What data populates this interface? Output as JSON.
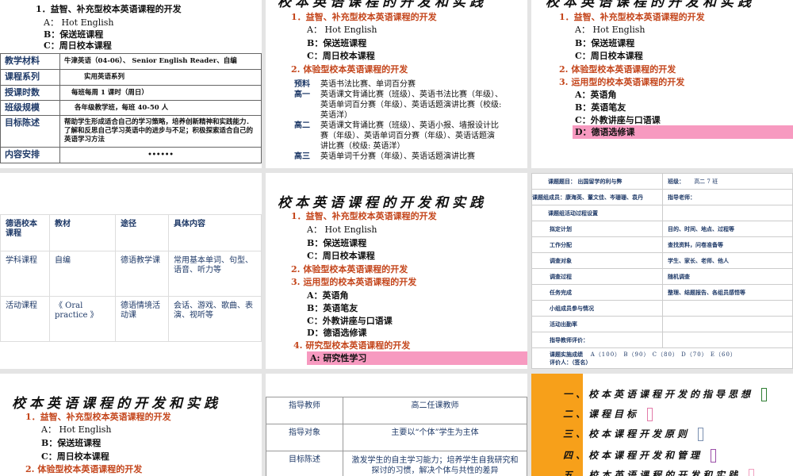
{
  "common": {
    "title": "校本英语课程的开发和实践",
    "item1": "1．益智、补充型校本英语课程的开发",
    "item1_a": "A： Hot English",
    "item1_b": "B：保送班课程",
    "item1_c": "C：周日校本课程",
    "item2": "2. 体验型校本英语课程的开发",
    "item3": "3. 运用型的校本英语课程的开发",
    "item3_a": "A：英语角",
    "item3_b": "B：英语笔友",
    "item3_c": "C：外教讲座与口语课",
    "item3_d": "D：德语选修课",
    "item4": "4. 研究型校本英语课程的开发",
    "item4_a": "A: 研究性学习"
  },
  "slide1": {
    "rows": [
      {
        "label": "教学材料",
        "value": "牛津英语（04-06）、 Senior English Reader、自编"
      },
      {
        "label": "课程系列",
        "value": "实用英语系列"
      },
      {
        "label": "授课时数",
        "value": "每班每周 1 课时（周日）"
      },
      {
        "label": "班级规模",
        "value": "各年级教学班，每班 40-50 人"
      },
      {
        "label": "目标陈述",
        "value": "帮助学生形成适合自己的学习策略，培养创新精神和实践能力．了解和反思自己学习英语中的进步与不足；积极探索适合自己的英语学习方法"
      },
      {
        "label": "内容安排",
        "value": "••••••"
      }
    ]
  },
  "slide2": {
    "grades": [
      {
        "label": "预料",
        "lines": [
          "英语书法比赛、单词百分赛"
        ]
      },
      {
        "label": "高一",
        "lines": [
          "英语课文背诵比赛（班级）、英语书法比赛（年级）、",
          "英语单词百分赛（年级）、英语话题演讲比赛（校级:",
          "英语洋）"
        ]
      },
      {
        "label": "高二",
        "lines": [
          "英语课文背诵比赛（班级）、英语小报、墙报设计比",
          "赛（年级）、英语单词百分赛（年级）、英语话题演",
          "讲比赛（校级: 英语洋）"
        ]
      },
      {
        "label": "高三",
        "lines": [
          "英语单词千分赛（年级）、英语话题演讲比赛"
        ]
      }
    ]
  },
  "slide4": {
    "headers": [
      "德语校本课程",
      "教材",
      "途径",
      "具体内容"
    ],
    "rows": [
      [
        "学科课程",
        "自编",
        "德语教学课",
        "常用基本单词、句型、语音、听力等"
      ],
      [
        "活动课程",
        "《 Oral practice 》",
        "德语情境活动课",
        "会话、游戏、歌曲、表演、视听等"
      ]
    ]
  },
  "slide6": {
    "topic_label": "课题题目：  出国留学的利与弊",
    "class_label": "班级：",
    "class_value": "高二 7 班",
    "members": "课题组成员：康海英、董文佳、岑珊珊、袁丹",
    "teacher": "指导老师：",
    "rows": [
      [
        "课题组活动过程设置",
        ""
      ],
      [
        "拟定计划",
        "目的、时间、地点、过程等"
      ],
      [
        "工作分配",
        "查找资料，问卷准备等"
      ],
      [
        "调查对象",
        "学生、家长、老师、他人"
      ],
      [
        "调查过程",
        "随机调查"
      ],
      [
        "任务完成",
        "整理、结题报告、各组员感悟等"
      ],
      [
        "小组成员参与情况",
        ""
      ],
      [
        "活动出勤率",
        ""
      ],
      [
        "指导教师评价：",
        ""
      ]
    ],
    "grade_label": "课题实施成绩",
    "grades": "A（100） B（90） C（80） D（70） E（60）",
    "evaluator": "评价人：（签名）"
  },
  "slide8": {
    "rows": [
      [
        "指导教师",
        "高二任课教师"
      ],
      [
        "指导对象",
        "主要以“个体”学生为主体"
      ],
      [
        "目标陈述",
        "激发学生的自主学习能力；培养学生自我研究和探讨的习惯，解决个体与共性的差异"
      ]
    ]
  },
  "slide9": {
    "accent": "#f7a01a",
    "items": [
      {
        "text": "一、校本英语课程开发的指导思想",
        "color": "#2e7d32"
      },
      {
        "text": "二、课程目标",
        "color": "#e27aa8"
      },
      {
        "text": "三、校本课程开发原则",
        "color": "#7a8fb0"
      },
      {
        "text": "四、校本课程开发和管理",
        "color": "#9b4fa8"
      },
      {
        "text": "五、校本英语课程的开发和实践",
        "color": "#f0a0c0"
      }
    ]
  }
}
